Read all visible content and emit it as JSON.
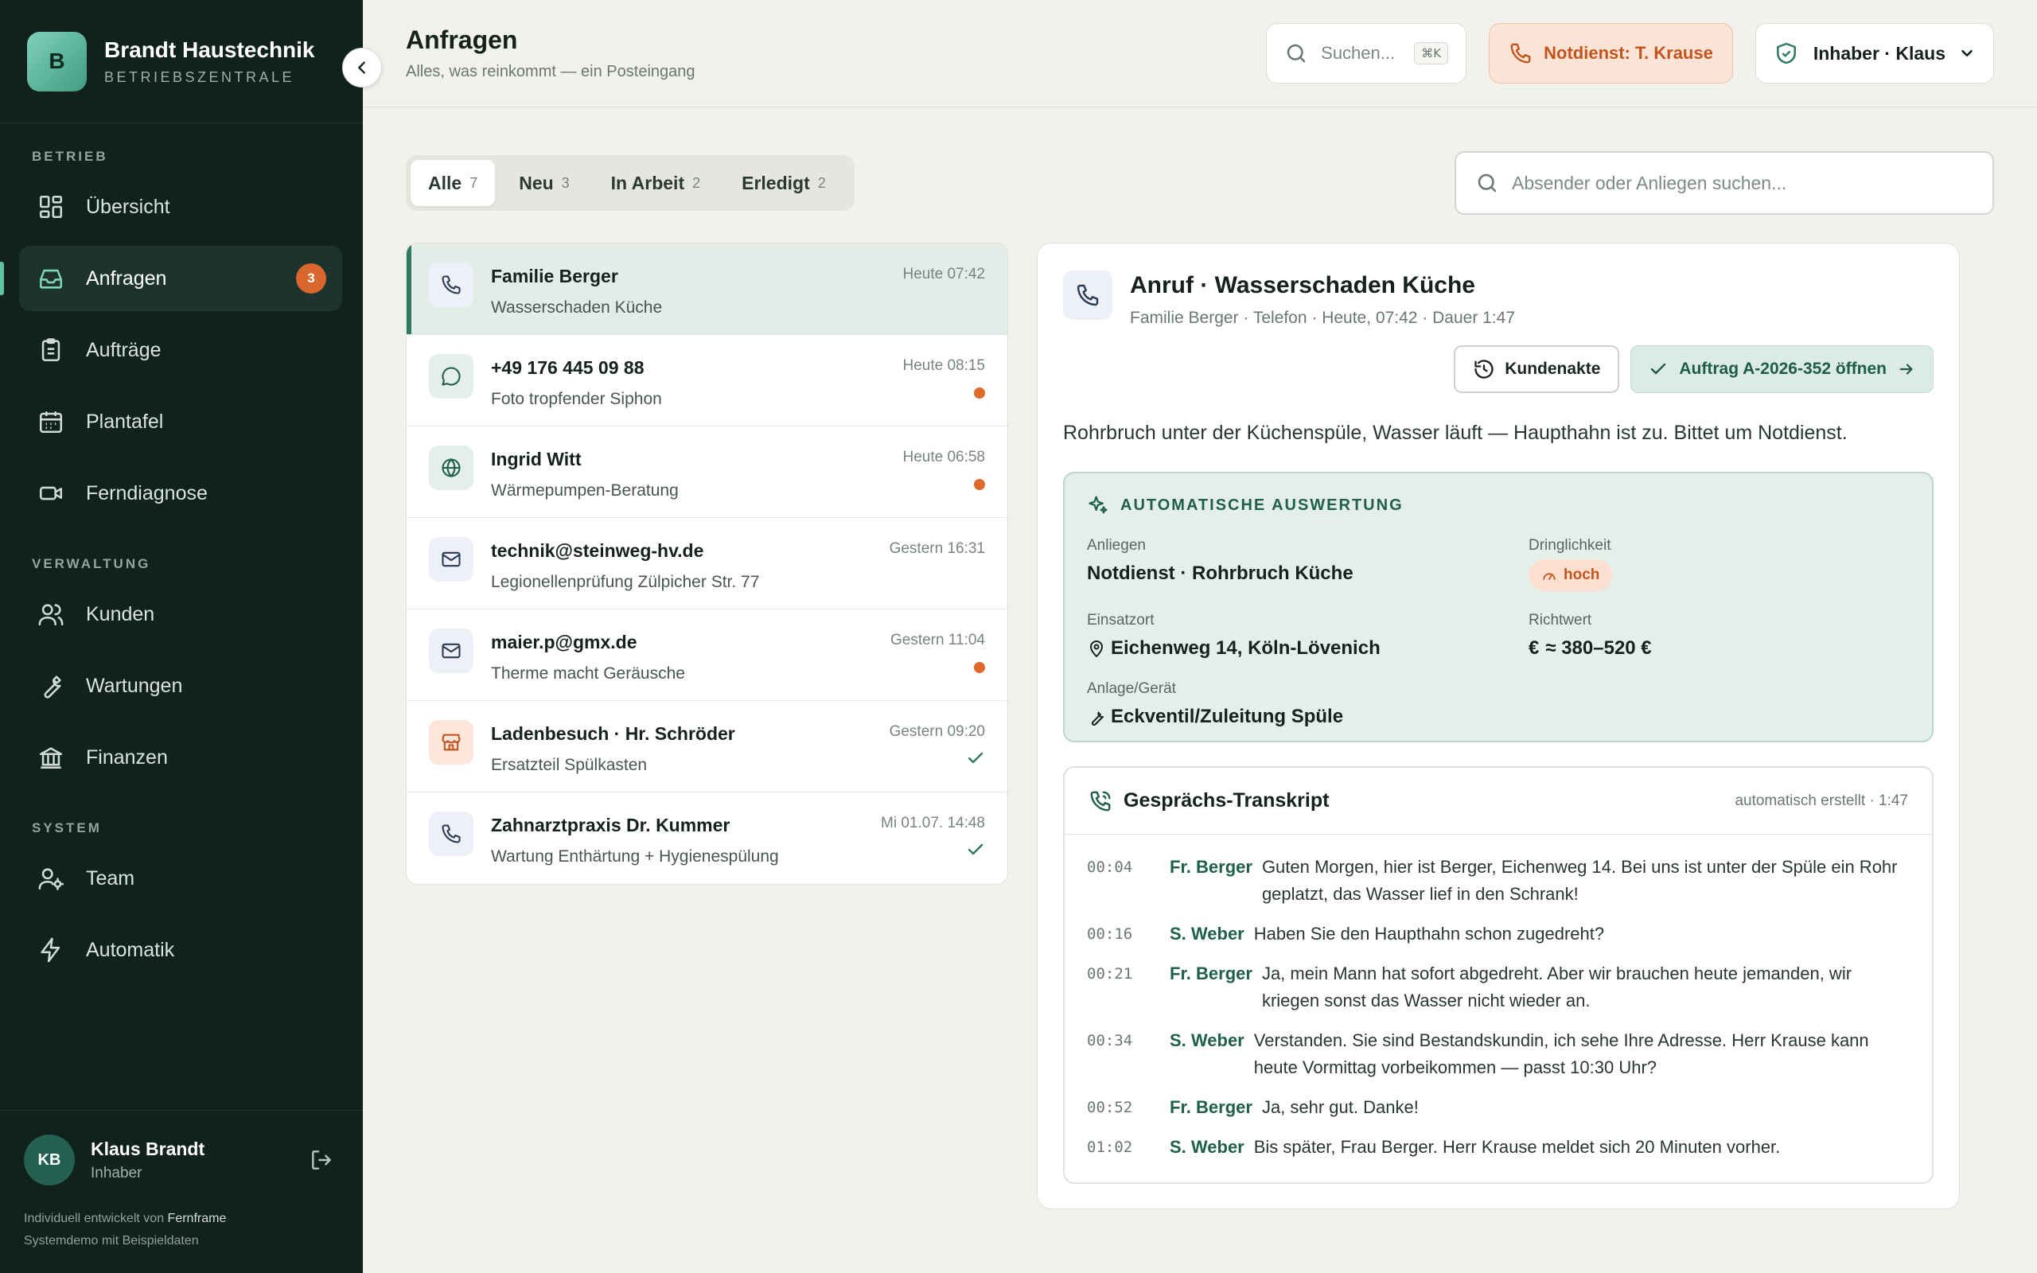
{
  "brand": {
    "logo_letter": "B",
    "name": "Brandt Haustechnik",
    "subtitle": "BETRIEBSZENTRALE"
  },
  "sidebar": {
    "sections": [
      {
        "label": "BETRIEB",
        "items": [
          {
            "label": "Übersicht",
            "icon": "grid-icon"
          },
          {
            "label": "Anfragen",
            "icon": "inbox-icon",
            "active": true,
            "badge": "3"
          },
          {
            "label": "Aufträge",
            "icon": "clipboard-icon"
          },
          {
            "label": "Plantafel",
            "icon": "calendar-icon"
          },
          {
            "label": "Ferndiagnose",
            "icon": "video-icon"
          }
        ]
      },
      {
        "label": "VERWALTUNG",
        "items": [
          {
            "label": "Kunden",
            "icon": "users-icon"
          },
          {
            "label": "Wartungen",
            "icon": "wrench-icon"
          },
          {
            "label": "Finanzen",
            "icon": "bank-icon"
          }
        ]
      },
      {
        "label": "SYSTEM",
        "items": [
          {
            "label": "Team",
            "icon": "user-gear-icon"
          },
          {
            "label": "Automatik",
            "icon": "bolt-icon"
          }
        ]
      }
    ],
    "user": {
      "initials": "KB",
      "name": "Klaus Brandt",
      "role": "Inhaber"
    },
    "credit_prefix": "Individuell entwickelt von",
    "credit_company": "Fernframe",
    "credit_line2": "Systemdemo mit Beispieldaten"
  },
  "header": {
    "title": "Anfragen",
    "subtitle": "Alles, was reinkommt — ein Posteingang",
    "search_placeholder": "Suchen...",
    "search_shortcut": "⌘K",
    "emergency": "Notdienst: T. Krause",
    "owner": "Inhaber · Klaus"
  },
  "tabs": [
    {
      "label": "Alle",
      "count": "7",
      "active": true
    },
    {
      "label": "Neu",
      "count": "3"
    },
    {
      "label": "In Arbeit",
      "count": "2"
    },
    {
      "label": "Erledigt",
      "count": "2"
    }
  ],
  "filter_search_placeholder": "Absender oder Anliegen suchen...",
  "inbox": [
    {
      "channel": "phone",
      "title": "Familie Berger",
      "subtitle": "Wasserschaden Küche",
      "time": "Heute 07:42",
      "status": "none",
      "selected": true
    },
    {
      "channel": "chat",
      "title": "+49 176 445 09 88",
      "subtitle": "Foto tropfender Siphon",
      "time": "Heute 08:15",
      "status": "new"
    },
    {
      "channel": "web",
      "title": "Ingrid Witt",
      "subtitle": "Wärmepumpen-Beratung",
      "time": "Heute 06:58",
      "status": "new"
    },
    {
      "channel": "mail",
      "title": "technik@steinweg-hv.de",
      "subtitle": "Legionellenprüfung Zülpicher Str. 77",
      "time": "Gestern 16:31",
      "status": "none"
    },
    {
      "channel": "mail",
      "title": "maier.p@gmx.de",
      "subtitle": "Therme macht Geräusche",
      "time": "Gestern 11:04",
      "status": "new"
    },
    {
      "channel": "store",
      "title": "Ladenbesuch · Hr. Schröder",
      "subtitle": "Ersatzteil Spülkasten",
      "time": "Gestern 09:20",
      "status": "done"
    },
    {
      "channel": "phone",
      "title": "Zahnarztpraxis Dr. Kummer",
      "subtitle": "Wartung Enthärtung + Hygienespülung",
      "time": "Mi 01.07. 14:48",
      "status": "done"
    }
  ],
  "detail": {
    "title": "Anruf · Wasserschaden Küche",
    "meta": "Familie Berger · Telefon · Heute, 07:42 · Dauer 1:47",
    "btn_record": "Kundenakte",
    "btn_order": "Auftrag A-2026-352 öffnen",
    "message": "Rohrbruch unter der Küchenspüle, Wasser läuft — Haupthahn ist zu. Bittet um Notdienst.",
    "auto": {
      "title": "AUTOMATISCHE AUSWERTUNG",
      "concern_label": "Anliegen",
      "concern": "Notdienst · Rohrbruch Küche",
      "urgency_label": "Dringlichkeit",
      "urgency": "hoch",
      "location_label": "Einsatzort",
      "location": "Eichenweg 14, Köln-Lövenich",
      "estimate_label": "Richtwert",
      "estimate": "≈ 380–520 €",
      "device_label": "Anlage/Gerät",
      "device": "Eckventil/Zuleitung Spüle"
    },
    "transcript": {
      "title": "Gesprächs-Transkript",
      "meta": "automatisch erstellt · 1:47",
      "lines": [
        {
          "ts": "00:04",
          "speaker": "Fr. Berger",
          "text": "Guten Morgen, hier ist Berger, Eichenweg 14. Bei uns ist unter der Spüle ein Rohr geplatzt, das Wasser lief in den Schrank!"
        },
        {
          "ts": "00:16",
          "speaker": "S. Weber",
          "text": "Haben Sie den Haupthahn schon zugedreht?"
        },
        {
          "ts": "00:21",
          "speaker": "Fr. Berger",
          "text": "Ja, mein Mann hat sofort abgedreht. Aber wir brauchen heute jemanden, wir kriegen sonst das Wasser nicht wieder an."
        },
        {
          "ts": "00:34",
          "speaker": "S. Weber",
          "text": "Verstanden. Sie sind Bestandskundin, ich sehe Ihre Adresse. Herr Krause kann heute Vormittag vorbeikommen — passt 10:30 Uhr?"
        },
        {
          "ts": "00:52",
          "speaker": "Fr. Berger",
          "text": "Ja, sehr gut. Danke!"
        },
        {
          "ts": "01:02",
          "speaker": "S. Weber",
          "text": "Bis später, Frau Berger. Herr Krause meldet sich 20 Minuten vorher."
        }
      ]
    }
  },
  "colors": {
    "sidebar_bg": "#11221d",
    "accent": "#2f7a63",
    "warning": "#d9672d",
    "page_bg": "#f1f2ed"
  }
}
